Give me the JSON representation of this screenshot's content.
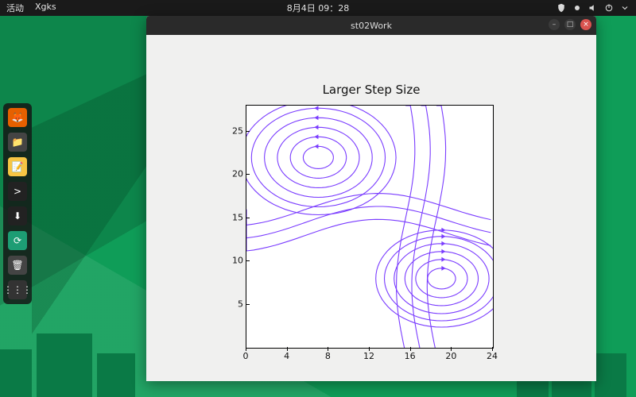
{
  "panel": {
    "activities": "活动",
    "app_menu": "Xgks",
    "clock": "8月4日 09：28",
    "tray": [
      "shield-icon",
      "volume-icon",
      "power-icon",
      "caret-icon"
    ]
  },
  "dock": {
    "items": [
      {
        "name": "firefox",
        "bg": "#e66000",
        "glyph": "🦊"
      },
      {
        "name": "files",
        "bg": "#444",
        "glyph": "📁"
      },
      {
        "name": "text-editor",
        "bg": "#f6c544",
        "glyph": "📝"
      },
      {
        "name": "terminal",
        "bg": "#222",
        "glyph": ">"
      },
      {
        "name": "downloads",
        "bg": "#222",
        "glyph": "⬇"
      },
      {
        "name": "software",
        "bg": "#1d9d74",
        "glyph": "⟳"
      },
      {
        "name": "trash",
        "bg": "#444",
        "glyph": "🗑"
      },
      {
        "name": "apps-grid",
        "bg": "#333",
        "glyph": "⋮⋮⋮"
      }
    ]
  },
  "window": {
    "title": "st02Work",
    "controls": {
      "minimize": "–",
      "maximize": "□",
      "close": "×"
    }
  },
  "chart_data": {
    "type": "streamline",
    "title": "Larger Step Size",
    "xlabel": "",
    "ylabel": "",
    "xlim": [
      0,
      24
    ],
    "ylim": [
      0,
      28
    ],
    "xticks": [
      0,
      4,
      8,
      12,
      16,
      20,
      24
    ],
    "yticks": [
      5,
      10,
      15,
      20,
      25
    ],
    "line_color": "#7a3cff",
    "field": "Streamline plot of a 2-vortex flow: counter-clockwise vortex centered near (7, 22), clockwise vortex centered near (19, 8), a saddle near (17, 18), concentric near-elliptical streamlines around each vortex with small arrowheads indicating direction.",
    "vortices": [
      {
        "cx": 7,
        "cy": 22,
        "sense": "ccw",
        "radii": [
          1.4,
          2.6,
          3.8,
          5.0,
          6.2,
          7.2
        ]
      },
      {
        "cx": 19,
        "cy": 8,
        "sense": "cw",
        "radii": [
          1.3,
          2.4,
          3.4,
          4.4,
          5.3,
          6.1
        ]
      }
    ],
    "saddle": {
      "x": 17,
      "y": 18
    }
  }
}
